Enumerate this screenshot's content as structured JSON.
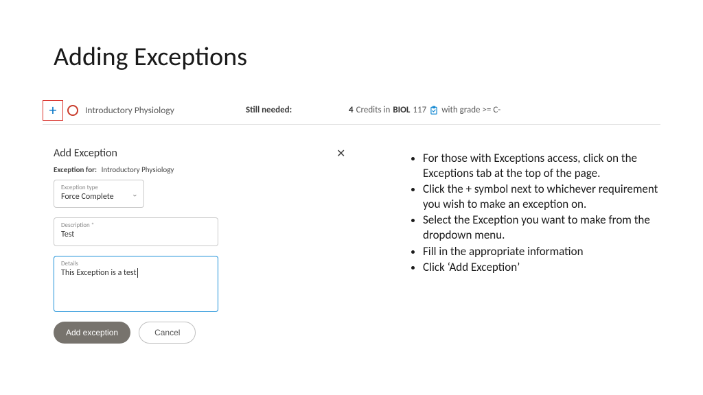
{
  "title": "Adding Exceptions",
  "requirement": {
    "course": "Introductory Physiology",
    "stillNeededLabel": "Still needed:",
    "creditsNum": "4",
    "creditsWord": "Credits in",
    "subject": "BIOL",
    "number": "117",
    "gradeText": "with grade >= C-"
  },
  "form": {
    "heading": "Add Exception",
    "forLabel": "Exception for:",
    "forValue": "Introductory Physiology",
    "typeLabel": "Exception type",
    "typeValue": "Force Complete",
    "descLabel": "Description *",
    "descValue": "Test",
    "detailsLabel": "Details",
    "detailsValue": "This Exception is a test",
    "addBtn": "Add exception",
    "cancelBtn": "Cancel"
  },
  "bullets": [
    "For those with Exceptions access, click on the Exceptions tab at the top of the page.",
    "Click the + symbol next to whichever requirement you wish to make an exception on.",
    "Select the Exception you want to make from the dropdown menu.",
    "Fill in the appropriate information",
    "Click ‘Add Exception’"
  ]
}
